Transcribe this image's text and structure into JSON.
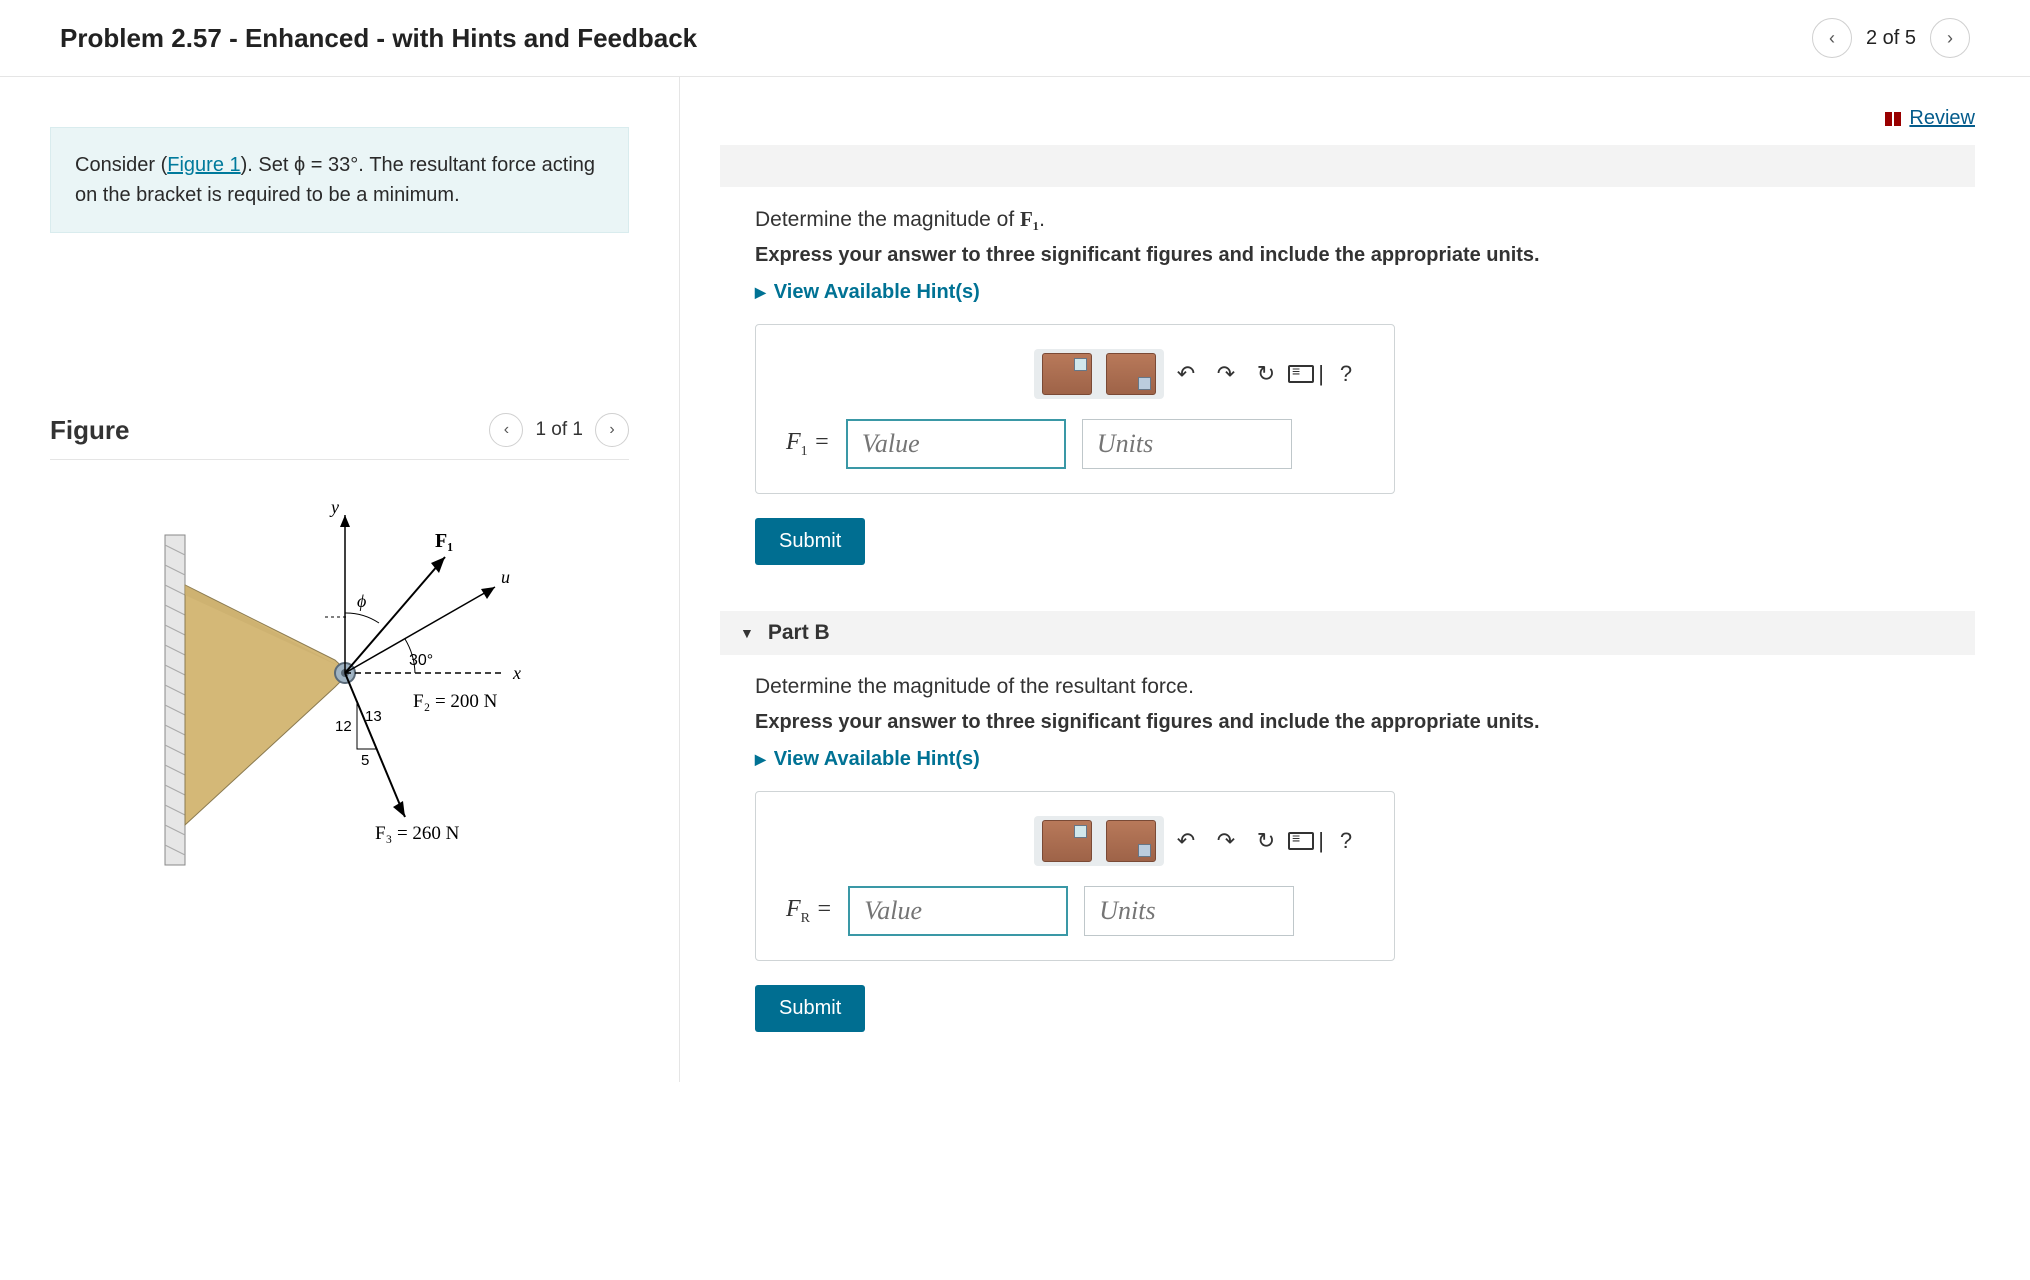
{
  "header": {
    "title": "Problem 2.57 - Enhanced - with Hints and Feedback",
    "page_counter": "2 of 5"
  },
  "review_label": "Review",
  "prompt": {
    "before_link": "Consider (",
    "link_text": "Figure 1",
    "after_link": "). Set ϕ = 33°. The resultant force acting on the bracket is required to be a minimum."
  },
  "figure": {
    "title": "Figure",
    "counter": "1 of 1",
    "labels": {
      "y": "y",
      "u": "u",
      "x": "x",
      "phi": "ϕ",
      "F1": "F₁",
      "angle30": "30°",
      "F2eq": "F₂ = 200 N",
      "F3eq": "F₃ = 260 N",
      "tri_a": "12",
      "tri_b": "13",
      "tri_c": "5"
    }
  },
  "partA": {
    "question_prefix": "Determine the magnitude of ",
    "question_var": "F₁",
    "question_suffix": ".",
    "instruction": "Express your answer to three significant figures and include the appropriate units.",
    "hints_label": "View Available Hint(s)",
    "var_label": "F₁ =",
    "value_placeholder": "Value",
    "units_placeholder": "Units",
    "submit": "Submit"
  },
  "partB": {
    "header": "Part B",
    "question": "Determine the magnitude of the resultant force.",
    "instruction": "Express your answer to three significant figures and include the appropriate units.",
    "hints_label": "View Available Hint(s)",
    "var_label_html": "F_R =",
    "var_label": "Fᵣ =",
    "value_placeholder": "Value",
    "units_placeholder": "Units",
    "submit": "Submit"
  },
  "toolbar": {
    "help": "?"
  }
}
